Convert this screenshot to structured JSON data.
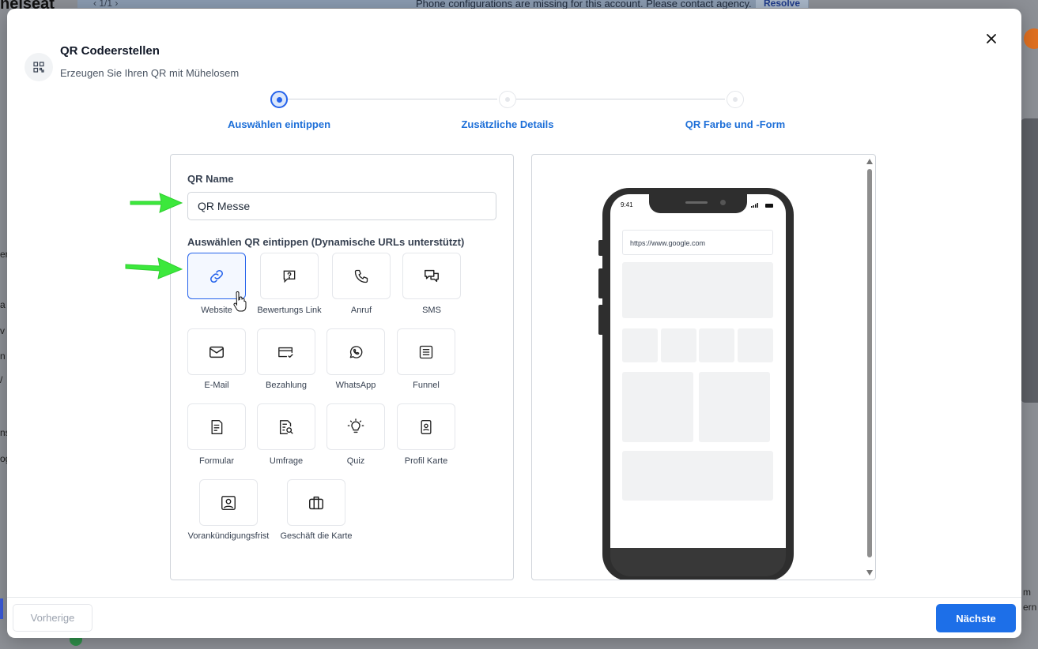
{
  "background": {
    "brand_fragment": "nelseat",
    "pager": "‹  1/1  ›",
    "banner": "Phone configurations are missing for this account. Please contact agency.",
    "resolve_label": "Resolve",
    "sidebar_fragments": [
      "er",
      "a",
      "v",
      "n",
      "/",
      "ns",
      "og"
    ],
    "right_fragments": [
      "m",
      "ern"
    ]
  },
  "modal": {
    "title": "QR Codeerstellen",
    "subtitle": "Erzeugen Sie Ihren QR mit Mühelosem",
    "header_icon": "qr-code-icon",
    "close_icon": "close-icon"
  },
  "stepper": {
    "steps": [
      {
        "label": "Auswählen eintippen",
        "state": "active"
      },
      {
        "label": "Zusätzliche Details",
        "state": "pending"
      },
      {
        "label": "QR Farbe und -Form",
        "state": "pending"
      }
    ],
    "accent": "#2563eb"
  },
  "form": {
    "name_label": "QR Name",
    "name_value": "QR Messe",
    "type_label": "Auswählen QR eintippen (Dynamische URLs unterstützt)",
    "types": [
      {
        "label": "Website",
        "icon": "link-icon",
        "selected": true
      },
      {
        "label": "Bewertungs Link",
        "icon": "review-question-icon",
        "selected": false
      },
      {
        "label": "Anruf",
        "icon": "phone-icon",
        "selected": false
      },
      {
        "label": "SMS",
        "icon": "chat-bubbles-icon",
        "selected": false
      },
      {
        "label": "E-Mail",
        "icon": "mail-icon",
        "selected": false
      },
      {
        "label": "Bezahlung",
        "icon": "credit-card-icon",
        "selected": false
      },
      {
        "label": "WhatsApp",
        "icon": "whatsapp-icon",
        "selected": false
      },
      {
        "label": "Funnel",
        "icon": "funnel-list-icon",
        "selected": false
      },
      {
        "label": "Formular",
        "icon": "form-document-icon",
        "selected": false
      },
      {
        "label": "Umfrage",
        "icon": "survey-search-icon",
        "selected": false
      },
      {
        "label": "Quiz",
        "icon": "lightbulb-icon",
        "selected": false
      },
      {
        "label": "Profil Karte",
        "icon": "profile-card-icon",
        "selected": false
      },
      {
        "label": "Vorankündigungsfrist",
        "icon": "contact-card-icon",
        "selected": false
      },
      {
        "label": "Geschäft die Karte",
        "icon": "briefcase-icon",
        "selected": false
      }
    ]
  },
  "preview": {
    "phone_time": "9:41",
    "url": "https://www.google.com"
  },
  "footer": {
    "prev_label": "Vorherige",
    "next_label": "Nächste",
    "next_color": "#1d6fe8"
  },
  "annotations": {
    "arrow_color": "#3ce83c"
  }
}
